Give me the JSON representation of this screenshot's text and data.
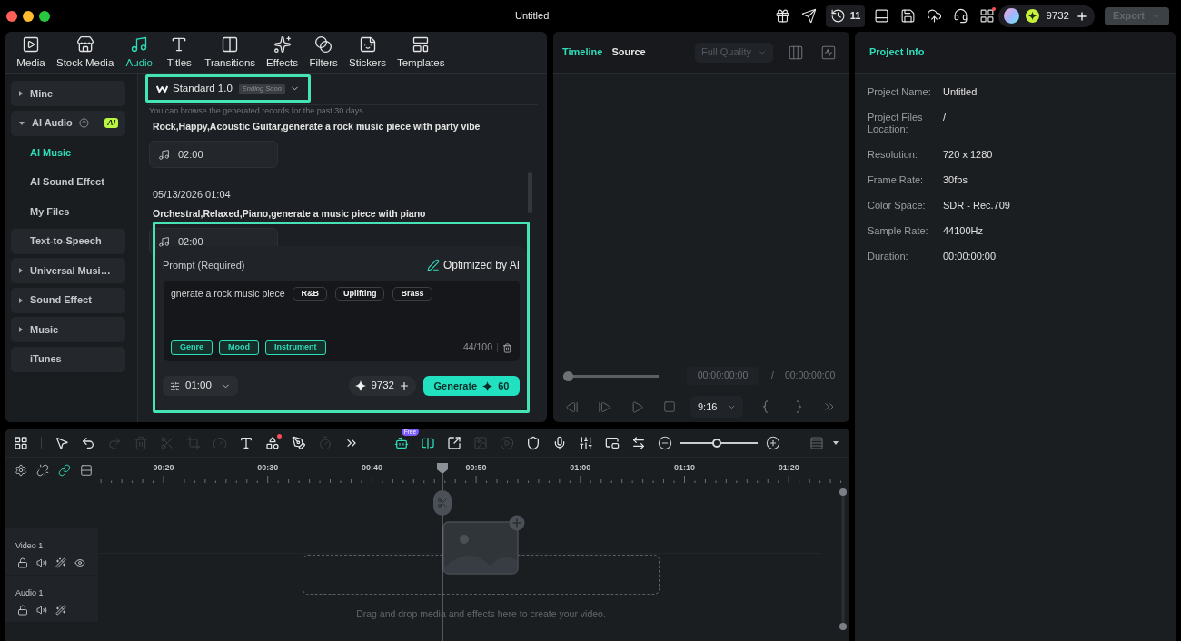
{
  "window": {
    "title": "Untitled"
  },
  "title_bar": {
    "tools": [
      {
        "kind": "icon",
        "notification": false
      },
      {
        "kind": "icon",
        "notification": false
      },
      {
        "kind": "counter",
        "count": "11",
        "notification": false
      },
      {
        "kind": "icon",
        "notification": false
      },
      {
        "kind": "icon",
        "notification": false
      },
      {
        "kind": "icon",
        "notification": false
      },
      {
        "kind": "icon",
        "notification": false
      },
      {
        "kind": "icon",
        "notification": true
      }
    ],
    "credits": "9732",
    "export": {
      "label": "Export",
      "disabled": true
    }
  },
  "media_tabs": [
    {
      "label": "Media",
      "selected": false
    },
    {
      "label": "Stock Media",
      "selected": false
    },
    {
      "label": "Audio",
      "selected": true
    },
    {
      "label": "Titles",
      "selected": false
    },
    {
      "label": "Transitions",
      "selected": false
    },
    {
      "label": "Effects",
      "selected": false
    },
    {
      "label": "Filters",
      "selected": false
    },
    {
      "label": "Stickers",
      "selected": false
    },
    {
      "label": "Templates",
      "selected": false
    }
  ],
  "sidebar": {
    "items": [
      {
        "kind": "folder",
        "label": "Mine",
        "expanded": false,
        "selected": false
      },
      {
        "kind": "folder",
        "label": "AI Audio",
        "expanded": true,
        "selected": false,
        "help_icon": true,
        "badge": "AI",
        "children": [
          {
            "label": "AI Music",
            "selected": true
          },
          {
            "label": "AI Sound Effect",
            "selected": false
          },
          {
            "label": "My Files",
            "selected": false
          }
        ]
      },
      {
        "kind": "link",
        "label": "Text-to-Speech",
        "selected": false
      },
      {
        "kind": "folder",
        "label": "Universal Musi…",
        "expanded": false,
        "selected": false
      },
      {
        "kind": "folder",
        "label": "Sound Effect",
        "expanded": false,
        "selected": false
      },
      {
        "kind": "folder",
        "label": "Music",
        "expanded": false,
        "selected": false
      },
      {
        "kind": "link",
        "label": "iTunes",
        "selected": false
      }
    ]
  },
  "ai_music": {
    "model_selector": {
      "label": "Standard 1.0",
      "badge": "Ending Soon",
      "highlighted": true
    },
    "hint": "You can browse the generated records for the past 30 days.",
    "records": [
      {
        "title": "Rock,Happy,Acoustic Guitar,generate a rock music piece with party vibe",
        "duration": "02:00"
      },
      {
        "date": "05/13/2026 01:04",
        "title": "Orchestral,Relaxed,Piano,generate a music piece with piano",
        "duration": "02:00"
      }
    ],
    "prompt_panel": {
      "highlighted": true,
      "label": "Prompt (Required)",
      "optimized_label": "Optimized by AI",
      "text": "gnerate a rock music piece",
      "tags": [
        "R&B",
        "Uplifting",
        "Brass"
      ],
      "categories": [
        "Genre",
        "Mood",
        "Instrument"
      ],
      "counter": "44/100",
      "duration": "01:00",
      "credits": "9732",
      "generate": {
        "label": "Generate",
        "cost": "60"
      }
    }
  },
  "preview": {
    "tabs": [
      {
        "label": "Timeline",
        "selected": true
      },
      {
        "label": "Source",
        "selected": false
      }
    ],
    "quality": {
      "label": "Full Quality",
      "disabled": true
    },
    "progress": {
      "level": 0
    },
    "current_time": "00:00:00:00",
    "separator": "/",
    "total_time": "00:00:00:00",
    "aspect": "9:16"
  },
  "project_info": {
    "title": "Project Info",
    "rows": [
      {
        "label": "Project Name:",
        "value": "Untitled"
      },
      {
        "label": "Project Files Location:",
        "value": "/"
      },
      {
        "label": "Resolution:",
        "value": "720 x 1280"
      },
      {
        "label": "Frame Rate:",
        "value": "30fps"
      },
      {
        "label": "Color Space:",
        "value": "SDR - Rec.709"
      },
      {
        "label": "Sample Rate:",
        "value": "44100Hz"
      },
      {
        "label": "Duration:",
        "value": "00:00:00:00"
      }
    ]
  },
  "timeline": {
    "tools": [
      {
        "disabled": false,
        "active": false,
        "notification": false
      },
      {
        "disabled": false,
        "active": false,
        "notification": false
      },
      {
        "disabled": false,
        "active": false,
        "notification": false
      },
      {
        "disabled": true,
        "active": false,
        "notification": false
      },
      {
        "disabled": true,
        "active": false,
        "notification": false
      },
      {
        "disabled": true,
        "active": false,
        "notification": false
      },
      {
        "disabled": true,
        "active": false,
        "notification": false
      },
      {
        "disabled": true,
        "active": false,
        "notification": false
      },
      {
        "disabled": false,
        "active": false,
        "notification": false
      },
      {
        "disabled": false,
        "active": false,
        "notification": true
      },
      {
        "disabled": false,
        "active": false,
        "notification": false
      },
      {
        "disabled": true,
        "active": false,
        "notification": false
      },
      {
        "disabled": false,
        "active": false,
        "notification": false
      },
      {
        "disabled": false,
        "active": true,
        "notification": false,
        "badge": "Free"
      },
      {
        "disabled": false,
        "active": true,
        "notification": false
      },
      {
        "disabled": false,
        "active": false,
        "notification": false
      },
      {
        "disabled": true,
        "active": false,
        "notification": false
      },
      {
        "disabled": true,
        "active": false,
        "notification": false
      },
      {
        "disabled": false,
        "active": false,
        "notification": false
      },
      {
        "disabled": false,
        "active": false,
        "notification": false
      },
      {
        "disabled": false,
        "active": false,
        "notification": false
      },
      {
        "disabled": false,
        "active": false,
        "notification": false
      },
      {
        "disabled": false,
        "active": false,
        "notification": false
      }
    ],
    "zoom": {
      "level": 0.47
    },
    "track_tools": [
      {
        "active": false
      },
      {
        "active": false
      },
      {
        "active": true
      },
      {
        "active": false
      }
    ],
    "ruler": [
      "00:20",
      "00:30",
      "00:40",
      "00:50",
      "01:00",
      "01:10",
      "01:20"
    ],
    "tracks": [
      {
        "kind": "video",
        "name": "Video 1"
      },
      {
        "kind": "audio",
        "name": "Audio 1"
      }
    ],
    "drop_hint": "Drag and drop media and effects here to create your video."
  }
}
